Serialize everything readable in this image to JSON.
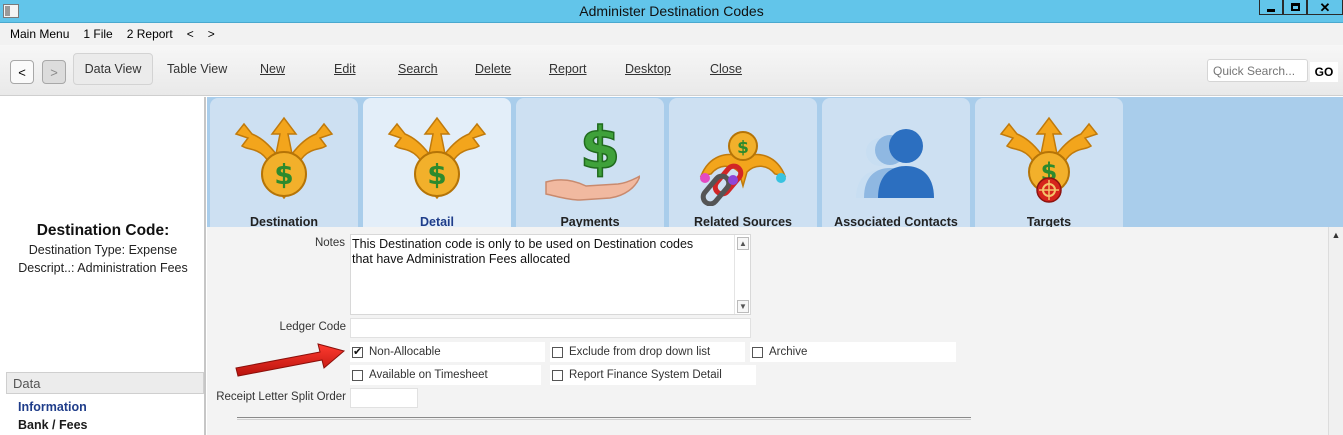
{
  "window": {
    "title": "Administer Destination Codes",
    "close_glyph": "✕"
  },
  "menu": {
    "items": [
      "Main Menu",
      "1 File",
      "2 Report",
      "<",
      ">"
    ]
  },
  "toolbar": {
    "back_glyph": "<",
    "forward_glyph": ">",
    "items": [
      {
        "label": "Data View",
        "active": true
      },
      {
        "label": "Table View"
      },
      {
        "label": "New"
      },
      {
        "label": "Edit"
      },
      {
        "label": "Search"
      },
      {
        "label": "Delete"
      },
      {
        "label": "Report"
      },
      {
        "label": "Desktop"
      },
      {
        "label": "Close"
      }
    ],
    "quick_search_placeholder": "Quick Search...",
    "go_label": "GO"
  },
  "left_panel": {
    "title": "Destination Code:",
    "type_line": "Destination Type: Expense",
    "description_line": "Descript..: Administration Fees",
    "data_header": "Data",
    "links": [
      "Information",
      "Bank / Fees"
    ]
  },
  "tabs": [
    {
      "label": "Destination",
      "icon": "dollar-arrows-icon"
    },
    {
      "label": "Detail",
      "icon": "dollar-arrows-icon",
      "active": true
    },
    {
      "label": "Payments",
      "icon": "hand-dollar-icon"
    },
    {
      "label": "Related Sources",
      "icon": "dollar-chain-icon"
    },
    {
      "label": "Associated Contacts",
      "icon": "contacts-icon"
    },
    {
      "label": "Targets",
      "icon": "dollar-target-icon"
    }
  ],
  "form": {
    "notes_label": "Notes",
    "notes_line1": "This Destination code is only to be used on Destination codes",
    "notes_line2": "that have Administration Fees allocated",
    "ledger_label": "Ledger Code",
    "ledger_value": "",
    "checkboxes": [
      {
        "label": "Non-Allocable",
        "checked": true
      },
      {
        "label": "Exclude from drop down list",
        "checked": false
      },
      {
        "label": "Archive",
        "checked": false
      },
      {
        "label": "Available on Timesheet",
        "checked": false
      },
      {
        "label": "Report Finance System Detail",
        "checked": false
      }
    ],
    "receipt_label": "Receipt Letter Split Order",
    "receipt_value": ""
  },
  "colors": {
    "titlebar": "#62c5ea",
    "tab_bg": "#a9cdeb",
    "annotation_arrow": "#e0201c"
  }
}
